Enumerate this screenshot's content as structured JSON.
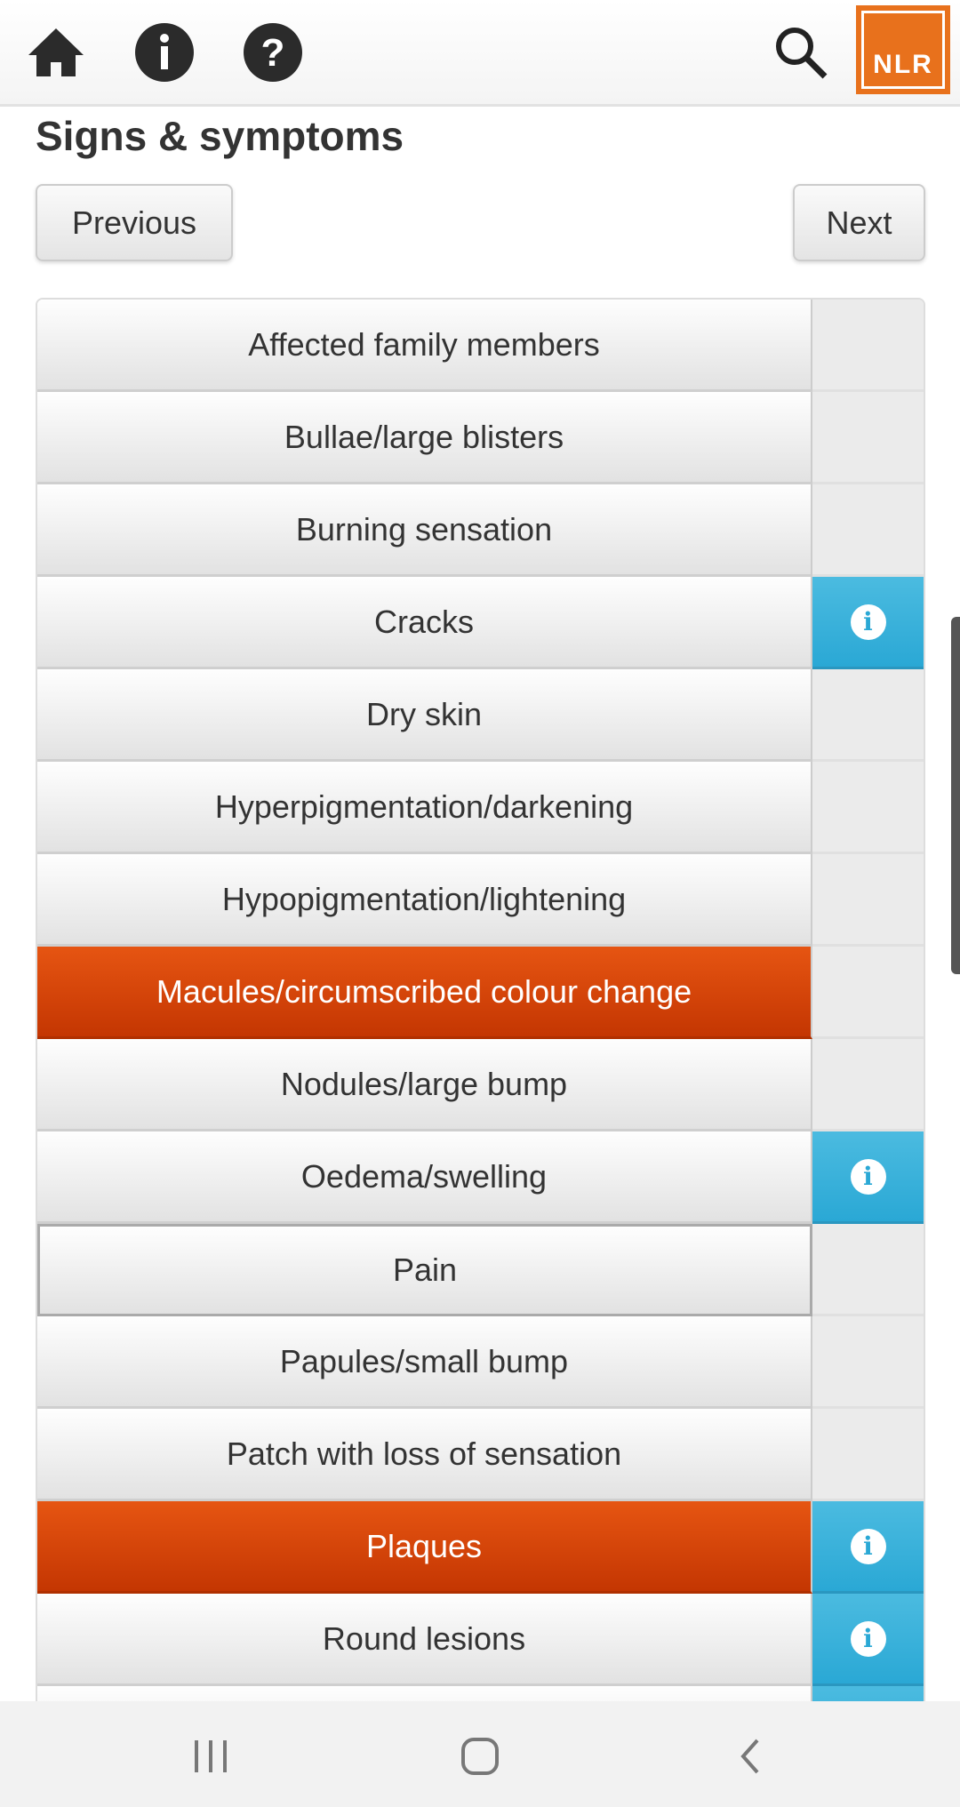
{
  "header": {
    "icons": [
      "home-icon",
      "info-icon",
      "help-icon",
      "search-icon"
    ],
    "logo_text": "NLR",
    "brand_color": "#e8711c"
  },
  "page": {
    "title": "Signs & symptoms",
    "previous_label": "Previous",
    "next_label": "Next"
  },
  "items": [
    {
      "label": "Affected family members",
      "selected": false,
      "info": false
    },
    {
      "label": "Bullae/large blisters",
      "selected": false,
      "info": false
    },
    {
      "label": "Burning sensation",
      "selected": false,
      "info": false
    },
    {
      "label": "Cracks",
      "selected": false,
      "info": true
    },
    {
      "label": "Dry skin",
      "selected": false,
      "info": false
    },
    {
      "label": "Hyperpigmentation/darkening",
      "selected": false,
      "info": false
    },
    {
      "label": "Hypopigmentation/lightening",
      "selected": false,
      "info": false
    },
    {
      "label": "Macules/circumscribed colour change",
      "selected": true,
      "info": false
    },
    {
      "label": "Nodules/large bump",
      "selected": false,
      "info": false
    },
    {
      "label": "Oedema/swelling",
      "selected": false,
      "info": true
    },
    {
      "label": "Pain",
      "selected": false,
      "info": false,
      "focused": true
    },
    {
      "label": "Papules/small bump",
      "selected": false,
      "info": false
    },
    {
      "label": "Patch with loss of sensation",
      "selected": false,
      "info": false
    },
    {
      "label": "Plaques",
      "selected": true,
      "info": true
    },
    {
      "label": "Round lesions",
      "selected": false,
      "info": true
    },
    {
      "label": "",
      "selected": false,
      "info": true
    }
  ],
  "colors": {
    "selected": "#d8480a",
    "info": "#2aa8d5"
  }
}
